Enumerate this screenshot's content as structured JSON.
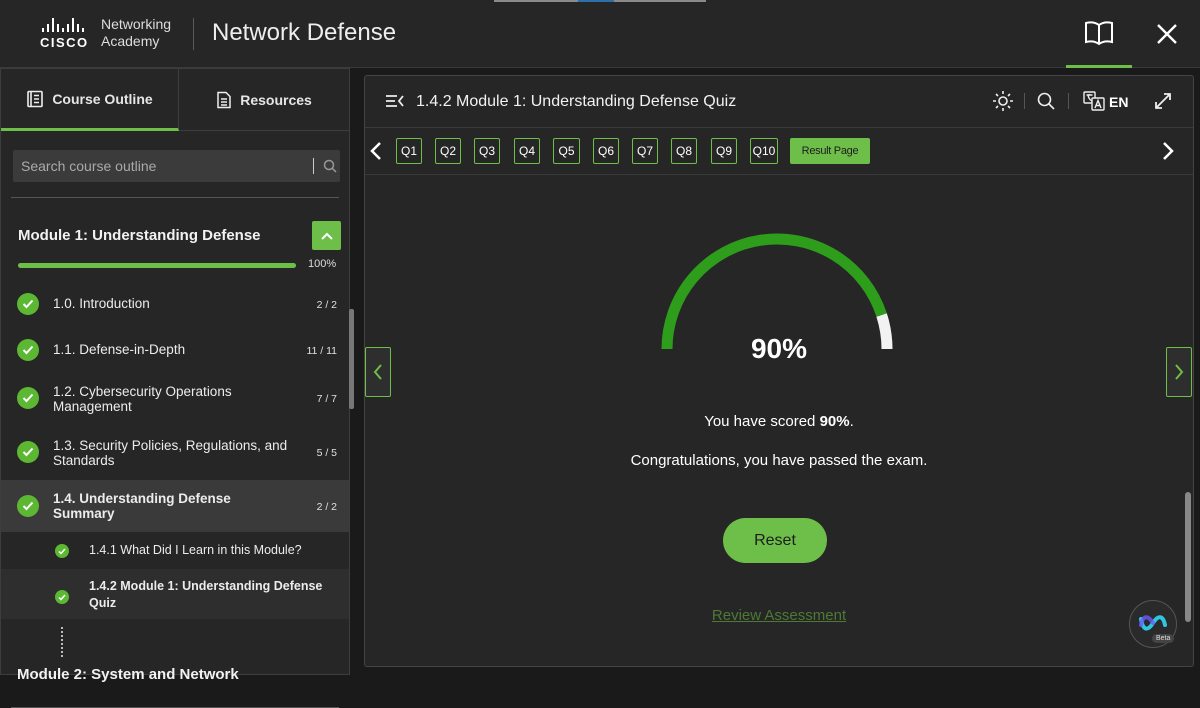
{
  "app": {
    "logo_line1": "Networking",
    "logo_line2": "Academy",
    "logo_brand": "CISCO",
    "title": "Network Defense",
    "icons": {
      "book": "book-icon",
      "close": "close-icon"
    }
  },
  "sidebar": {
    "tabs": [
      {
        "label": "Course Outline",
        "icon": "outline-icon",
        "active": true
      },
      {
        "label": "Resources",
        "icon": "document-icon",
        "active": false
      }
    ],
    "search_placeholder": "Search course outline",
    "module": {
      "title": "Module 1: Understanding Defense",
      "progress_pct": "100%",
      "progress_value": 1.0
    },
    "items": [
      {
        "label": "1.0. Introduction",
        "count": "2 / 2"
      },
      {
        "label": "1.1. Defense-in-Depth",
        "count": "11 / 11"
      },
      {
        "label": "1.2. Cybersecurity Operations Management",
        "count": "7 / 7"
      },
      {
        "label": "1.3. Security Policies, Regulations, and Standards",
        "count": "5 / 5"
      },
      {
        "label": "1.4. Understanding Defense Summary",
        "count": "2 / 2"
      }
    ],
    "subitems": [
      {
        "label": "1.4.1 What Did I Learn in this Module?"
      },
      {
        "label": "1.4.2 Module 1: Understanding Defense Quiz"
      }
    ],
    "next_module": "Module 2: System and Network"
  },
  "main": {
    "quiz_title": "1.4.2 Module 1: Understanding Defense Quiz",
    "language": "EN",
    "questions": [
      "Q1",
      "Q2",
      "Q3",
      "Q4",
      "Q5",
      "Q6",
      "Q7",
      "Q8",
      "Q9",
      "Q10"
    ],
    "result_page_label": "Result Page",
    "score_value": 90,
    "score_display": "90%",
    "score_prefix": "You have scored ",
    "score_bold": "90%",
    "score_suffix": ".",
    "congrats": "Congratulations, you have passed the exam.",
    "reset_label": "Reset",
    "review_label": "Review Assessment"
  },
  "colors": {
    "accent": "#6ebe4a",
    "gauge_fill": "#2e9d1c",
    "gauge_rest": "#f2f2f2",
    "background": "#1a1a1a",
    "panel": "#262626"
  },
  "webex": {
    "badge": "Beta"
  }
}
